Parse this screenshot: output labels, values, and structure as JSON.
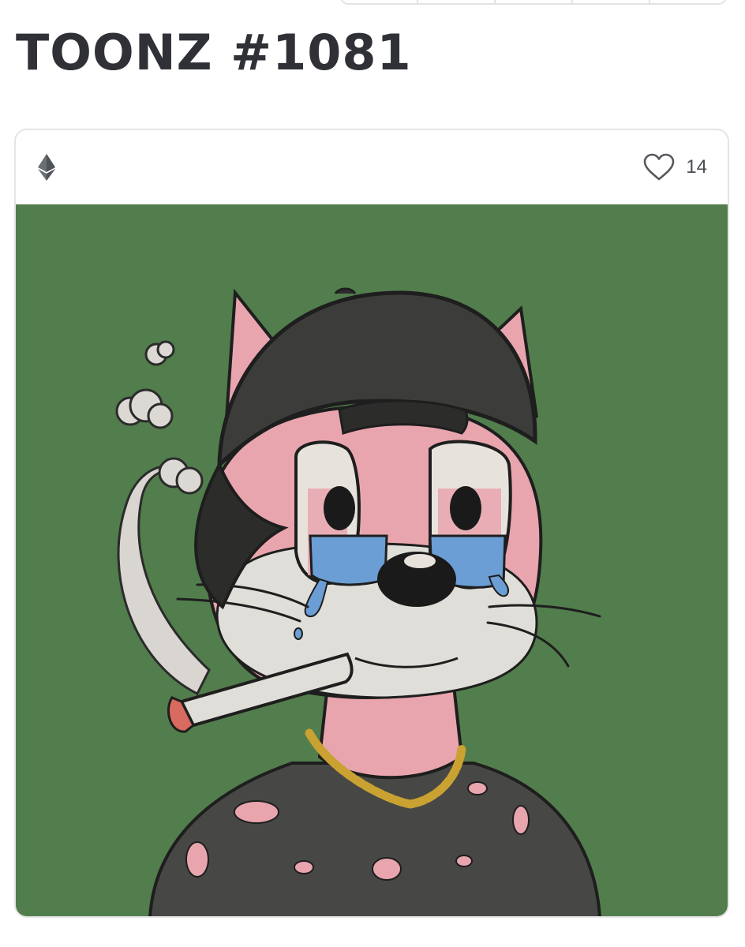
{
  "page": {
    "title": "TOONZ #1081"
  },
  "card": {
    "chain_icon": "ethereum-icon",
    "favorite_icon": "heart-outline-icon",
    "favorite_count": "14"
  },
  "artwork": {
    "background_color": "#527d4c",
    "subject": "cat-character-illustration"
  }
}
